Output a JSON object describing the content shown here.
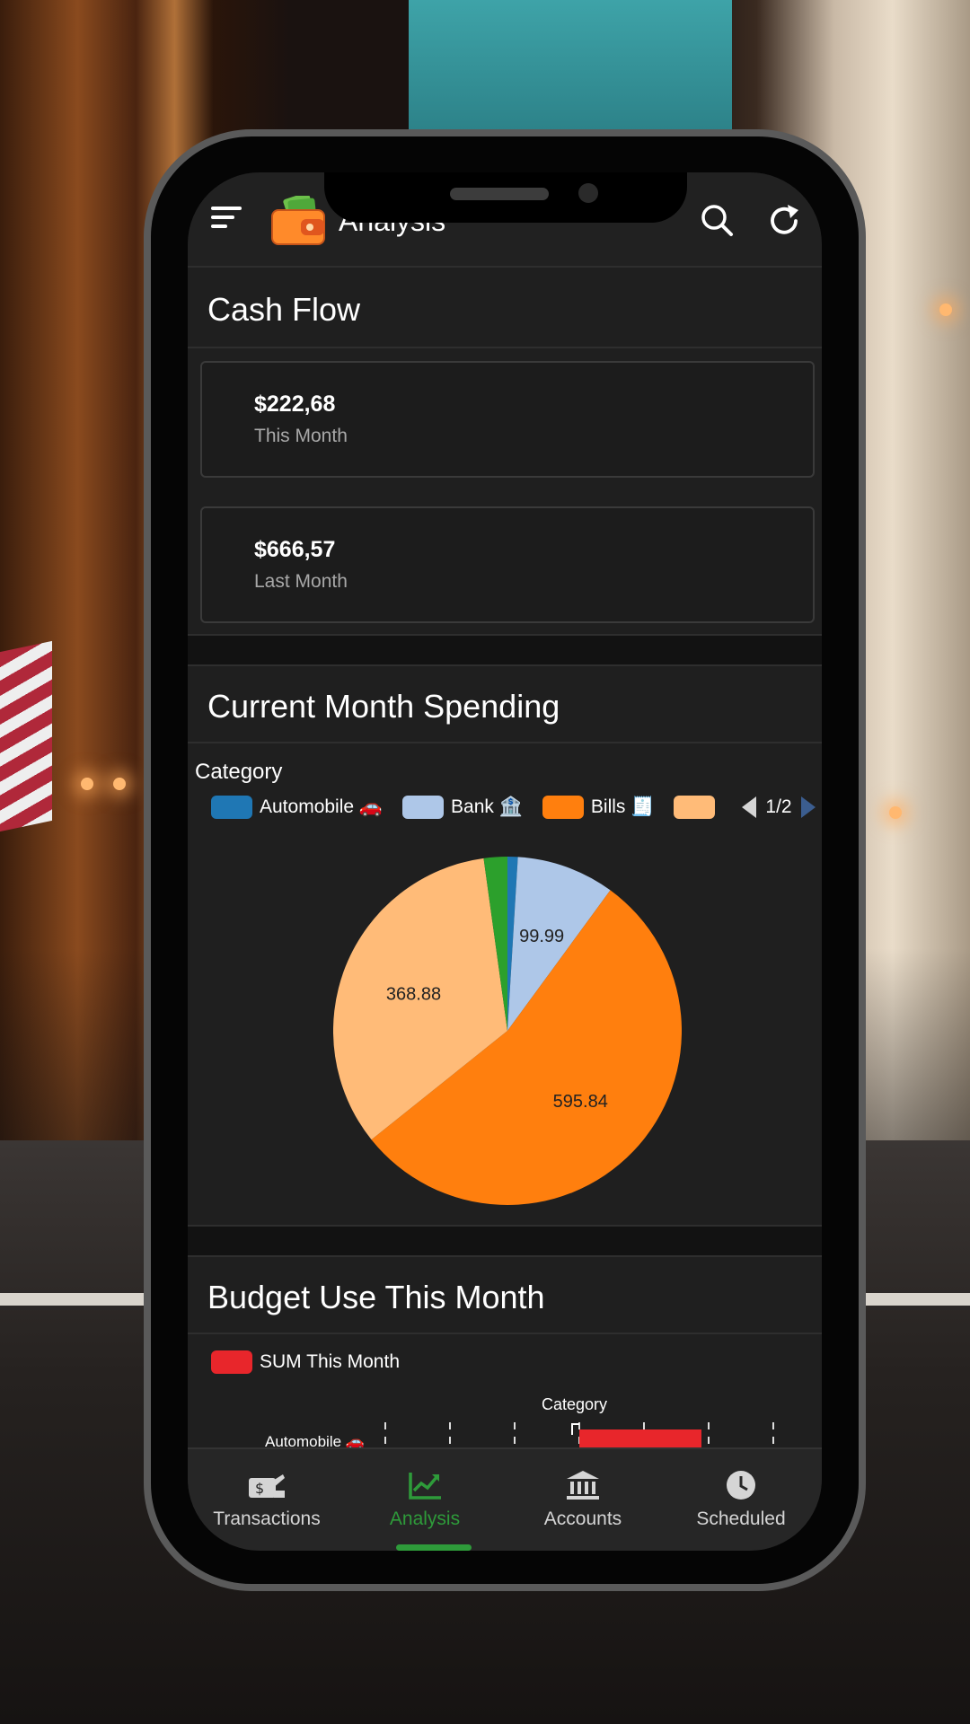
{
  "app_bar": {
    "title": "Analysis",
    "icons": [
      "menu-icon",
      "wallet-icon",
      "search-icon",
      "refresh-icon"
    ]
  },
  "cash_flow": {
    "title": "Cash Flow",
    "this_month": {
      "amount": "$222,68",
      "label": "This Month"
    },
    "last_month": {
      "amount": "$666,57",
      "label": "Last Month"
    }
  },
  "spending": {
    "title": "Current Month Spending",
    "legend_title": "Category",
    "legend": [
      {
        "label": "Automobile 🚗",
        "color": "#1f77b4"
      },
      {
        "label": "Bank 🏦",
        "color": "#aec7e8"
      },
      {
        "label": "Bills 🧾",
        "color": "#ff7f0e"
      },
      {
        "label": "",
        "color": "#ffbb78"
      }
    ],
    "pager": "1/2"
  },
  "chart_data": [
    {
      "type": "pie",
      "title": "Current Month Spending",
      "categories": [
        "Automobile 🚗",
        "Bank 🏦",
        "Bills 🧾",
        "",
        ""
      ],
      "values": [
        10.5,
        99.99,
        595.84,
        368.88,
        24.0
      ],
      "data_labels": [
        "",
        "99.99",
        "595.84",
        "368.88",
        ""
      ],
      "colors": [
        "#1f77b4",
        "#aec7e8",
        "#ff7f0e",
        "#ffbb78",
        "#2ca02c"
      ]
    }
  ],
  "budget": {
    "title": "Budget Use This Month",
    "legend_label": "SUM This Month",
    "legend_color": "#e8262b",
    "axis_label": "Category",
    "row_label": "Automobile 🚗"
  },
  "bottom_nav": {
    "items": [
      {
        "label": "Transactions",
        "icon": "transactions-icon"
      },
      {
        "label": "Analysis",
        "icon": "analysis-icon"
      },
      {
        "label": "Accounts",
        "icon": "bank-icon"
      },
      {
        "label": "Scheduled",
        "icon": "clock-icon"
      }
    ],
    "active": "Analysis",
    "active_color": "#2e9b3a"
  }
}
